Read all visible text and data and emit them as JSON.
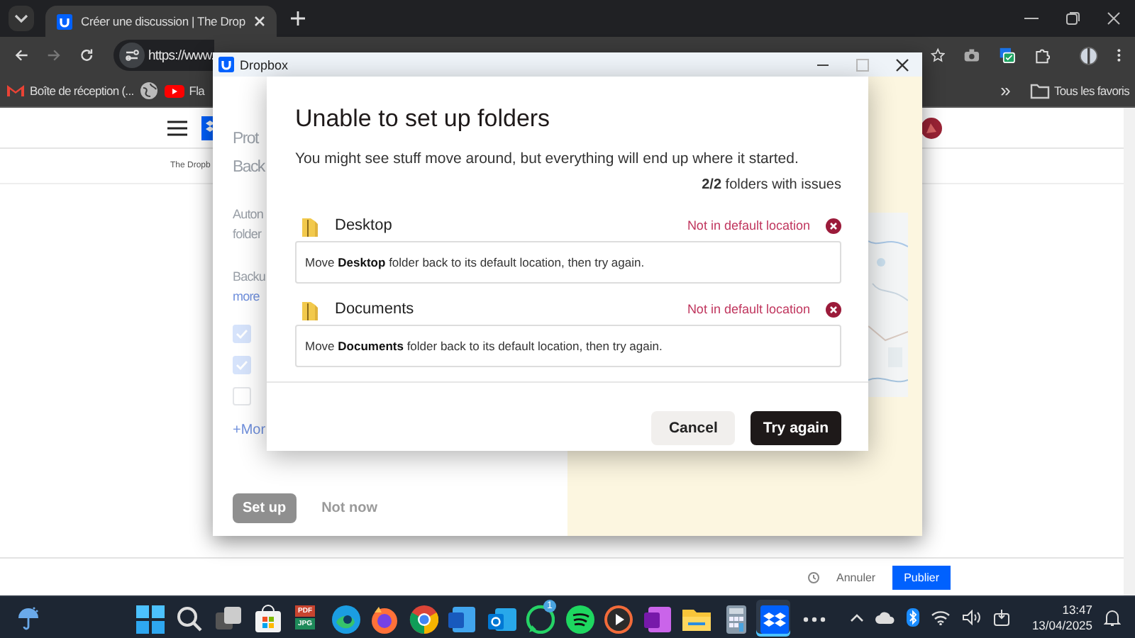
{
  "browser": {
    "tabs": [
      {
        "title": "Créer une discussion | The Drop",
        "selected": true
      }
    ],
    "address": "https://www.",
    "bookmarks": [
      {
        "kind": "gmail",
        "label": "Boîte de réception (..."
      },
      {
        "kind": "globe"
      },
      {
        "kind": "youtube",
        "label": "Fla"
      }
    ],
    "bookmarks_overflow": "»",
    "all_bookmarks": "Tous les favoris",
    "page": {
      "breadcrumb": "The Dropb",
      "cancel": "Annuler",
      "publish": "Publier"
    }
  },
  "dropbox_window": {
    "title": "Dropbox",
    "heading_lines": [
      "Prot",
      "Back"
    ],
    "description_lines": [
      "Auton",
      "folder"
    ],
    "backup_line": "Backu",
    "link": "more",
    "folders": [
      {
        "checked": true
      },
      {
        "checked": true
      },
      {
        "checked": false
      }
    ],
    "more": "+Mor",
    "primary_button": "Set up",
    "secondary_button": "Not now"
  },
  "dialog": {
    "title": "Unable to set up folders",
    "subtitle": "You might see stuff move around, but everything will end up where it started.",
    "count": "**2/2** folders with issues",
    "folders": [
      {
        "name": "Desktop",
        "status": "Not in default location",
        "message": "Move **Desktop** folder back to its default location, then try again."
      },
      {
        "name": "Documents",
        "status": "Not in default location",
        "message": "Move **Documents** folder back to its default location, then try again."
      }
    ],
    "buttons": [
      {
        "kind": "secondary",
        "label": "Cancel"
      },
      {
        "kind": "primary",
        "label": "Try again"
      }
    ]
  },
  "taskbar": {
    "apps": [
      {
        "kind": "windows",
        "selected": false
      },
      {
        "kind": "search",
        "selected": false
      },
      {
        "kind": "taskview",
        "selected": false
      },
      {
        "kind": "store",
        "selected": false
      },
      {
        "kind": "pdfjpg",
        "selected": false,
        "top": "PDF",
        "bottom": "JPG"
      },
      {
        "kind": "edge",
        "selected": false
      },
      {
        "kind": "firefox",
        "selected": false
      },
      {
        "kind": "chrome",
        "selected": false
      },
      {
        "kind": "word",
        "selected": false
      },
      {
        "kind": "outlook",
        "selected": false
      },
      {
        "kind": "whatsapp",
        "selected": false,
        "badge": "1"
      },
      {
        "kind": "spotify",
        "selected": false
      },
      {
        "kind": "player",
        "selected": false
      },
      {
        "kind": "onenote",
        "selected": false
      },
      {
        "kind": "files",
        "selected": false
      },
      {
        "kind": "calculator",
        "selected": false
      },
      {
        "kind": "dropbox",
        "selected": true
      },
      {
        "kind": "more",
        "selected": false
      }
    ],
    "time": "13:47",
    "date": "13/04/2025"
  }
}
